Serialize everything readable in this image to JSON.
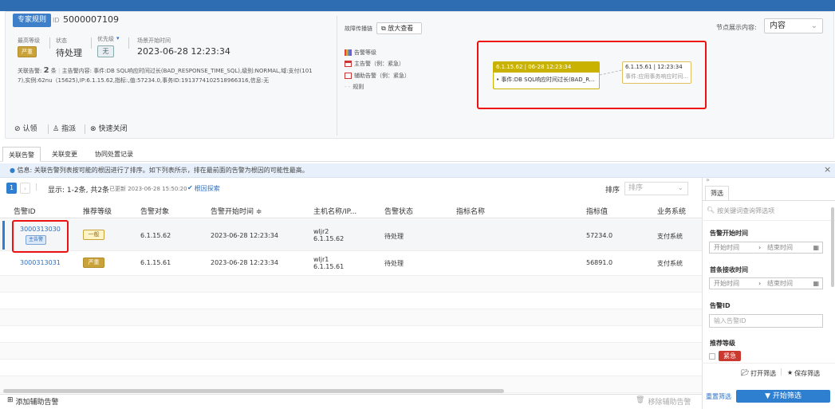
{
  "header": {
    "tag": "专家规则",
    "id_label": "ID",
    "alarm_id": "5000007109",
    "severity_label": "最高等级",
    "severity_value": "严重",
    "status_label": "状态",
    "status_value": "待处理",
    "priority_label": "优先级",
    "priority_value": "无",
    "start_label": "场景开始时间",
    "start_value": "2023-06-28 12:23:34",
    "assoc_label": "关联告警:",
    "assoc_count": "2",
    "assoc_unit": "条",
    "main_content_label": "主告警内容:",
    "main_content_line1": "事件:DB SQL响应时间过长(BAD_RESPONSE_TIME_SQL),级别:NORMAL,域:支付(101",
    "main_content_line2": "7),实例:62nu（15625),IP:6.1.15.62,指标:,值:57234.0,事务ID:1913774102518966316,信息:无",
    "actions": [
      "认领",
      "指派",
      "快速关闭"
    ]
  },
  "graph": {
    "fault_label": "故障传播链",
    "zoom_button": "放大查看",
    "legend": [
      "告警等级",
      "主告警（例：紧急）",
      "辅助告警（例：紧急）",
      "规则"
    ],
    "node_display_label": "节点展示内容:",
    "node_display_value": "内容",
    "node1_header": "6.1.15.62 | 06-28 12:23:34",
    "node1_body": "• 事件:DB SQL响应时间过长(BAD_R...",
    "node2_header": "6.1.15.61 | 12:23:34",
    "node2_body": "事件:应用事务响应时间..."
  },
  "tabs": [
    "关联告警",
    "关联变更",
    "协同处置记录"
  ],
  "info_text": "信息: 关联告警列表按可能的根因进行了排序。如下列表所示，排在最前面的告警为根因的可能性最高。",
  "toolbar": {
    "page": "1",
    "summary": "显示: 1-2条, 共2条",
    "updated": "已更新 2023-06-28 15:50:20",
    "root_cause": "根因探索",
    "sort_label": "排序",
    "sort_placeholder": "排序"
  },
  "table": {
    "headers": [
      "告警ID",
      "推荐等级",
      "告警对象",
      "告警开始时间 ≑",
      "主机名称/IP...",
      "告警状态",
      "指标名称",
      "指标值",
      "业务系统"
    ],
    "rows": [
      {
        "id": "3000313030",
        "badge": "主告警",
        "level": "一般",
        "object": "6.1.15.62",
        "time": "2023-06-28 12:23:34",
        "host": "wljr2",
        "ip": "6.1.15.62",
        "status": "待处理",
        "metric": "",
        "value": "57234.0",
        "system": "支付系统"
      },
      {
        "id": "3000313031",
        "badge": "",
        "level": "严重",
        "object": "6.1.15.61",
        "time": "2023-06-28 12:23:34",
        "host": "wljr1",
        "ip": "6.1.15.61",
        "status": "待处理",
        "metric": "",
        "value": "56891.0",
        "system": "支付系统"
      }
    ]
  },
  "bottom": {
    "add_aux": "添加辅助告警",
    "remove_aux": "移除辅助告警"
  },
  "filter": {
    "tab": "筛选",
    "search_placeholder": "按关键词查询筛选项",
    "alarm_start_label": "告警开始时间",
    "first_recv_label": "首条接收时间",
    "start_placeholder": "开始时间",
    "end_placeholder": "结束时间",
    "alarm_id_label": "告警ID",
    "alarm_id_placeholder": "输入告警ID",
    "rec_level_label": "推荐等级",
    "rec_level_option": "紧急",
    "open_filter": "打开筛选",
    "save_filter": "保存筛选",
    "reset": "重置筛选",
    "start": "开始筛选"
  },
  "colors": {
    "accent": "#2f7fd0",
    "severe": "#c9a23a",
    "highlight": "#e11111"
  }
}
